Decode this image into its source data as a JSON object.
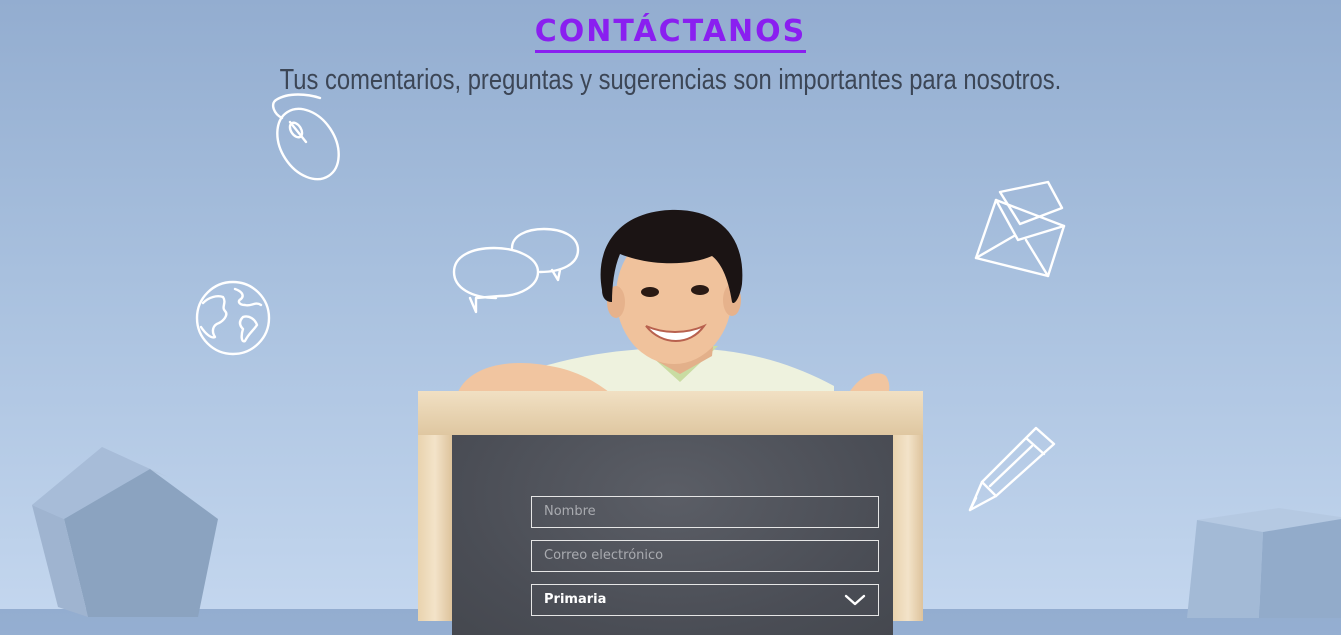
{
  "header": {
    "title": "CONTÁCTANOS",
    "subtitle": "Tus comentarios, preguntas y sugerencias son importantes para nosotros."
  },
  "form": {
    "name_placeholder": "Nombre",
    "email_placeholder": "Correo electrónico",
    "level_selected": "Primaria"
  },
  "colors": {
    "accent": "#8a1ff0",
    "background_top": "#93add0",
    "background_bottom": "#c3d6ee",
    "chalkboard": "#4a4d55"
  },
  "icons": [
    "mouse-icon",
    "chat-bubbles-icon",
    "globe-icon",
    "envelope-icon",
    "pencil-icon",
    "chevron-down-icon"
  ]
}
